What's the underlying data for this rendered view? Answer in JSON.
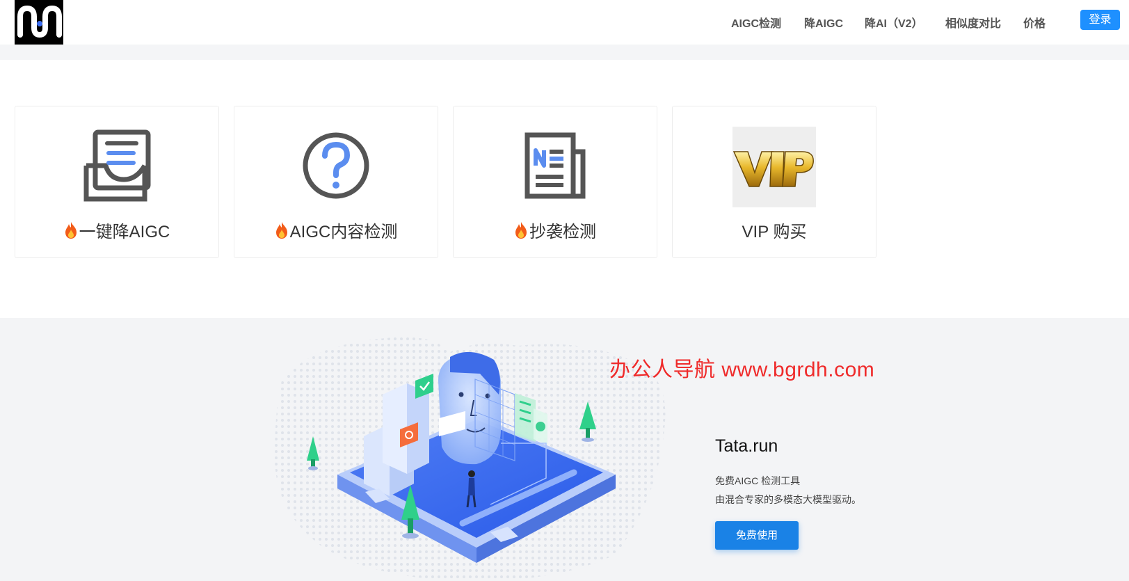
{
  "header": {
    "nav": [
      {
        "label": "AIGC检测"
      },
      {
        "label": "降AIGC"
      },
      {
        "label": "降AI（V2）"
      },
      {
        "label": "相似度对比"
      },
      {
        "label": "价格"
      }
    ],
    "login_label": "登录"
  },
  "cards": [
    {
      "label": "一键降AIGC",
      "icon": "inbox-document-icon",
      "hot": true
    },
    {
      "label": "AIGC内容检测",
      "icon": "question-circle-icon",
      "hot": true
    },
    {
      "label": "抄袭检测",
      "icon": "newspaper-icon",
      "hot": true
    },
    {
      "label": "VIP 购买",
      "icon": "vip-badge-icon",
      "hot": false
    }
  ],
  "hero": {
    "watermark": "办公人导航  www.bgrdh.com",
    "title": "Tata.run",
    "line1": "免费AIGC 检测工具",
    "line2": "由混合专家的多模态大模型驱动。",
    "cta_label": "免费使用"
  },
  "colors": {
    "accent": "#1e90ff",
    "icon_gray": "#555555",
    "icon_blue": "#5b8def",
    "watermark": "#ef2a2a",
    "vip_gold": "#d9a521"
  }
}
